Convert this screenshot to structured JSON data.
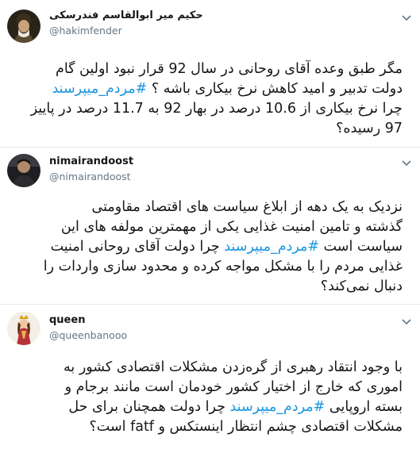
{
  "tweets": [
    {
      "name": "حکیم میر ابوالقاسم فندرسکی",
      "handle": "@hakimfender",
      "lines": [
        [
          "مگر طبق وعده آقای روحانی در سال 92 قرار نبود اولین گام",
          ""
        ],
        [
          "دولت تدبیر و امید کاهش نرخ بیکاری باشه ؟ ",
          "#مردم_میپرسند"
        ],
        [
          "چرا نرخ بیکاری از 10.6 درصد در بهار 92 به 11.7 درصد در پاییز",
          ""
        ],
        [
          "97 رسیده؟",
          ""
        ]
      ]
    },
    {
      "name": "nimairandoost",
      "handle": "@nimairandoost",
      "lines": [
        [
          "نزدیک به یک دهه از ابلاغ سیاست های اقتصاد مقاومتی",
          ""
        ],
        [
          "گذشته و تامین امنیت غذایی یکی از مهمترین مولفه های این",
          ""
        ],
        [
          "سیاست است ",
          "#مردم_میپرسند",
          " چرا دولت آقای روحانی امنیت"
        ],
        [
          "غذایی مردم را با مشکل مواجه کرده و محدود سازی واردات را",
          ""
        ],
        [
          "دنبال نمی‌کند؟",
          ""
        ]
      ]
    },
    {
      "name": "queen",
      "handle": "@queenbanooo",
      "lines": [
        [
          "با وجود انتقاد رهبری از گره‌زدن مشکلات اقتصادی کشور به",
          ""
        ],
        [
          "اموری که خارج از اختیار کشور خودمان است مانند برجام و",
          ""
        ],
        [
          "بسته اروپایی ",
          "#مردم_میپرسند",
          " چرا دولت همچنان برای حل"
        ],
        [
          "مشکلات اقتصادی چشم انتظار اینستکس و fatf است؟",
          ""
        ]
      ]
    }
  ],
  "colors": {
    "hashtag": "#1b95e0",
    "handle": "#657786",
    "divider": "#e1e8ed"
  },
  "icons": [
    "chevron-down-icon",
    "avatar"
  ]
}
